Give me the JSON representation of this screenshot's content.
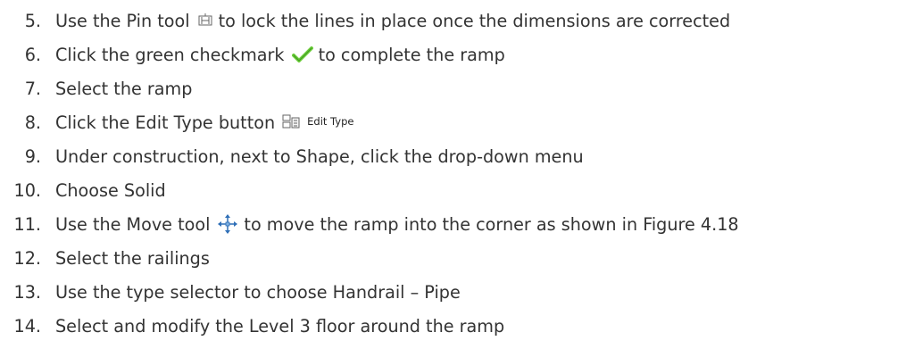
{
  "steps": [
    {
      "number": "5.",
      "before": "Use the Pin tool",
      "icon": "pin-icon",
      "after": "to lock the lines in place once the dimensions are corrected"
    },
    {
      "number": "6.",
      "before": "Click the green checkmark",
      "icon": "checkmark-icon",
      "after": "to complete the ramp"
    },
    {
      "number": "7.",
      "text": "Select the ramp"
    },
    {
      "number": "8.",
      "before": "Click the Edit Type button",
      "icon": "edit-type-icon",
      "button_label": "Edit Type"
    },
    {
      "number": "9.",
      "text": "Under construction, next to Shape, click the drop-down menu"
    },
    {
      "number": "10.",
      "text": "Choose Solid"
    },
    {
      "number": "11.",
      "before": "Use the Move tool",
      "icon": "move-icon",
      "after": "to move the ramp into the corner as shown in Figure 4.18"
    },
    {
      "number": "12.",
      "text": "Select the railings"
    },
    {
      "number": "13.",
      "text": "Use the type selector to choose Handrail – Pipe"
    },
    {
      "number": "14.",
      "text": "Select and modify the Level 3 floor around the ramp"
    }
  ],
  "colors": {
    "text": "#333333",
    "checkmark": "#6fcf3d",
    "icon_stroke": "#5a5a5a",
    "move_icon": "#2f6fb7"
  }
}
